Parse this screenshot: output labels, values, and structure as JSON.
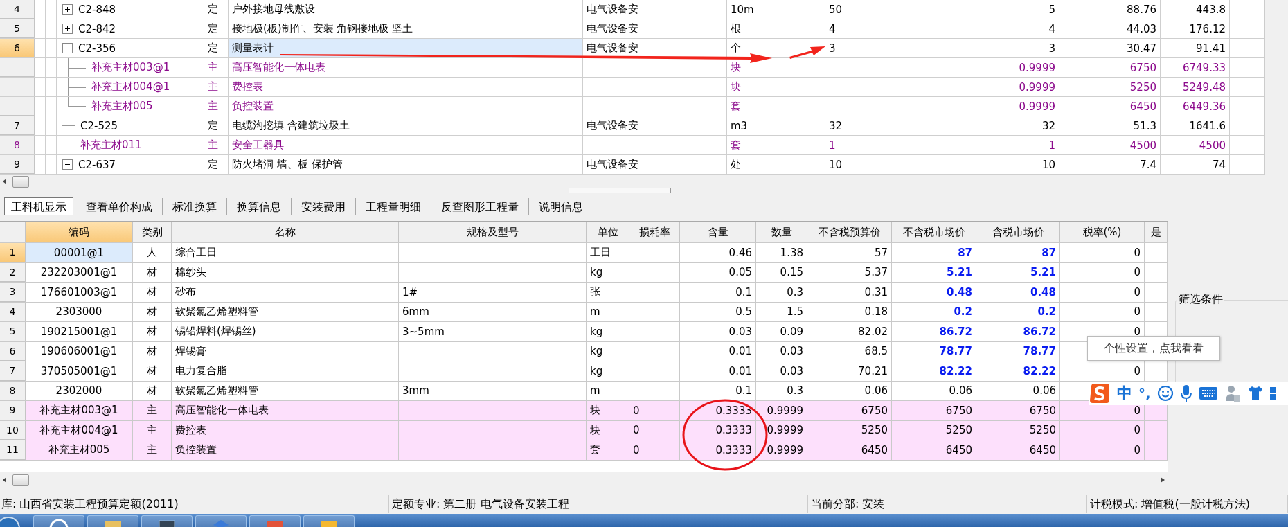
{
  "upper_table": {
    "rows": [
      {
        "number": "4",
        "expanded": false,
        "code": "C2-848",
        "type": "定",
        "name": "户外接地母线敷设",
        "specialty": "电气设备安",
        "unit": "10m",
        "quantity_expression": "50",
        "quantity": "5",
        "unit_price": "88.76",
        "total": "443.8",
        "kind": "item",
        "selected": false
      },
      {
        "number": "5",
        "expanded": false,
        "code": "C2-842",
        "type": "定",
        "name": "接地极(板)制作、安装 角钢接地极 坚土",
        "specialty": "电气设备安",
        "unit": "根",
        "quantity_expression": "4",
        "quantity": "4",
        "unit_price": "44.03",
        "total": "176.12",
        "kind": "item",
        "selected": false
      },
      {
        "number": "6",
        "expanded": true,
        "code": "C2-356",
        "type": "定",
        "name": "测量表计",
        "specialty": "电气设备安",
        "unit": "个",
        "quantity_expression": "3",
        "quantity": "3",
        "unit_price": "30.47",
        "total": "91.41",
        "kind": "item",
        "selected": true,
        "children": [
          {
            "code": "补充主材003@1",
            "type": "主",
            "name": "高压智能化一体电表",
            "unit": "块",
            "quantity": "0.9999",
            "unit_price": "6750",
            "total": "6749.33",
            "kind": "material",
            "selected": false
          },
          {
            "code": "补充主材004@1",
            "type": "主",
            "name": "费控表",
            "unit": "块",
            "quantity": "0.9999",
            "unit_price": "5250",
            "total": "5249.48",
            "kind": "material",
            "selected": false
          },
          {
            "code": "补充主材005",
            "type": "主",
            "name": "负控装置",
            "unit": "套",
            "quantity": "0.9999",
            "unit_price": "6450",
            "total": "6449.36",
            "kind": "material",
            "selected": false
          }
        ]
      },
      {
        "number": "7",
        "code": "C2-525",
        "type": "定",
        "name": "电缆沟挖填 含建筑垃圾土",
        "specialty": "电气设备安",
        "unit": "m3",
        "quantity_expression": "32",
        "quantity": "32",
        "unit_price": "51.3",
        "total": "1641.6",
        "kind": "item",
        "selected": false
      },
      {
        "number": "8",
        "code": "补充主材011",
        "type": "主",
        "name": "安全工器具",
        "unit": "套",
        "quantity_expression": "1",
        "quantity": "1",
        "unit_price": "4500",
        "total": "4500",
        "kind": "material",
        "selected": false
      },
      {
        "number": "9",
        "expanded": true,
        "code": "C2-637",
        "type": "定",
        "name": "防火堵洞 墙、板 保护管",
        "specialty": "电气设备安",
        "unit": "处",
        "quantity_expression": "10",
        "quantity": "10",
        "unit_price": "7.4",
        "total": "74",
        "kind": "item",
        "selected": false
      }
    ]
  },
  "tabs": [
    {
      "label": "工料机显示",
      "selected": true
    },
    {
      "label": "查看单价构成",
      "selected": false
    },
    {
      "label": "标准换算",
      "selected": false
    },
    {
      "label": "换算信息",
      "selected": false
    },
    {
      "label": "安装费用",
      "selected": false
    },
    {
      "label": "工程量明细",
      "selected": false
    },
    {
      "label": "反查图形工程量",
      "selected": false
    },
    {
      "label": "说明信息",
      "selected": false
    }
  ],
  "resource_table": {
    "columns": [
      {
        "label": "编码",
        "selected": true
      },
      {
        "label": "类别",
        "selected": false
      },
      {
        "label": "名称",
        "selected": false
      },
      {
        "label": "规格及型号",
        "selected": false
      },
      {
        "label": "单位",
        "selected": false
      },
      {
        "label": "损耗率",
        "selected": false
      },
      {
        "label": "含量",
        "selected": false
      },
      {
        "label": "数量",
        "selected": false
      },
      {
        "label": "不含税预算价",
        "selected": false
      },
      {
        "label": "不含税市场价",
        "selected": false
      },
      {
        "label": "含税市场价",
        "selected": false
      },
      {
        "label": "税率(%)",
        "selected": false
      },
      {
        "label": "是",
        "selected": false
      }
    ],
    "rows": [
      {
        "number": "1",
        "code": "00001@1",
        "type": "人",
        "name": "综合工日",
        "unit": "工日",
        "content": "0.46",
        "quantity": "1.38",
        "budget_price": "57",
        "market_price": "87",
        "market_price_with_tax": "87",
        "tax_rate": "0",
        "main_material": false,
        "price_adjusted": true,
        "selected": true
      },
      {
        "number": "2",
        "code": "232203001@1",
        "type": "材",
        "name": "棉纱头",
        "unit": "kg",
        "content": "0.05",
        "quantity": "0.15",
        "budget_price": "5.37",
        "market_price": "5.21",
        "market_price_with_tax": "5.21",
        "tax_rate": "0",
        "main_material": false,
        "price_adjusted": true,
        "selected": false
      },
      {
        "number": "3",
        "code": "176601003@1",
        "type": "材",
        "name": "砂布",
        "spec": "1#",
        "unit": "张",
        "content": "0.1",
        "quantity": "0.3",
        "budget_price": "0.31",
        "market_price": "0.48",
        "market_price_with_tax": "0.48",
        "tax_rate": "0",
        "main_material": false,
        "price_adjusted": true,
        "selected": false
      },
      {
        "number": "4",
        "code": "2303000",
        "type": "材",
        "name": "软聚氯乙烯塑料管",
        "spec": "6mm",
        "unit": "m",
        "content": "0.5",
        "quantity": "1.5",
        "budget_price": "0.18",
        "market_price": "0.2",
        "market_price_with_tax": "0.2",
        "tax_rate": "0",
        "main_material": false,
        "price_adjusted": true,
        "selected": false
      },
      {
        "number": "5",
        "code": "190215001@1",
        "type": "材",
        "name": "锡铅焊料(焊锡丝)",
        "spec": "3~5mm",
        "unit": "kg",
        "content": "0.03",
        "quantity": "0.09",
        "budget_price": "82.02",
        "market_price": "86.72",
        "market_price_with_tax": "86.72",
        "tax_rate": "0",
        "main_material": false,
        "price_adjusted": true,
        "selected": false
      },
      {
        "number": "6",
        "code": "190606001@1",
        "type": "材",
        "name": "焊锡膏",
        "unit": "kg",
        "content": "0.01",
        "quantity": "0.03",
        "budget_price": "68.5",
        "market_price": "78.77",
        "market_price_with_tax": "78.77",
        "main_material": false,
        "price_adjusted": true,
        "selected": false
      },
      {
        "number": "7",
        "code": "370505001@1",
        "type": "材",
        "name": "电力复合脂",
        "unit": "kg",
        "content": "0.01",
        "quantity": "0.03",
        "budget_price": "70.21",
        "market_price": "82.22",
        "market_price_with_tax": "82.22",
        "tax_rate": "0",
        "main_material": false,
        "price_adjusted": true,
        "selected": false
      },
      {
        "number": "8",
        "code": "2302000",
        "type": "材",
        "name": "软聚氯乙烯塑料管",
        "spec": "3mm",
        "unit": "m",
        "content": "0.1",
        "quantity": "0.3",
        "budget_price": "0.06",
        "market_price": "0.06",
        "market_price_with_tax": "0.06",
        "main_material": false,
        "price_adjusted": false,
        "selected": false
      },
      {
        "number": "9",
        "code": "补充主材003@1",
        "type": "主",
        "name": "高压智能化一体电表",
        "unit": "块",
        "loss": "0",
        "content": "0.3333",
        "quantity": "0.9999",
        "budget_price": "6750",
        "market_price": "6750",
        "market_price_with_tax": "6750",
        "tax_rate": "0",
        "main_material": true,
        "price_adjusted": false,
        "selected": false
      },
      {
        "number": "10",
        "code": "补充主材004@1",
        "type": "主",
        "name": "费控表",
        "unit": "块",
        "loss": "0",
        "content": "0.3333",
        "quantity": "0.9999",
        "budget_price": "5250",
        "market_price": "5250",
        "market_price_with_tax": "5250",
        "tax_rate": "0",
        "main_material": true,
        "price_adjusted": false,
        "selected": false
      },
      {
        "number": "11",
        "code": "补充主材005",
        "type": "主",
        "name": "负控装置",
        "unit": "套",
        "loss": "0",
        "content": "0.3333",
        "quantity": "0.9999",
        "budget_price": "6450",
        "market_price": "6450",
        "market_price_with_tax": "6450",
        "tax_rate": "0",
        "main_material": true,
        "price_adjusted": false,
        "selected": false
      }
    ]
  },
  "filter_panel": {
    "title": "筛选条件"
  },
  "tooltip": "个性设置，点我看看",
  "ime_toolbar": {
    "mode": "中",
    "punctuation": "°,"
  },
  "status_bar": [
    "库: 山西省安装工程预算定额(2011)",
    "定额专业: 第二册 电气设备安装工程",
    "当前分部: 安装",
    "计税模式: 增值税(一般计税方法)"
  ]
}
